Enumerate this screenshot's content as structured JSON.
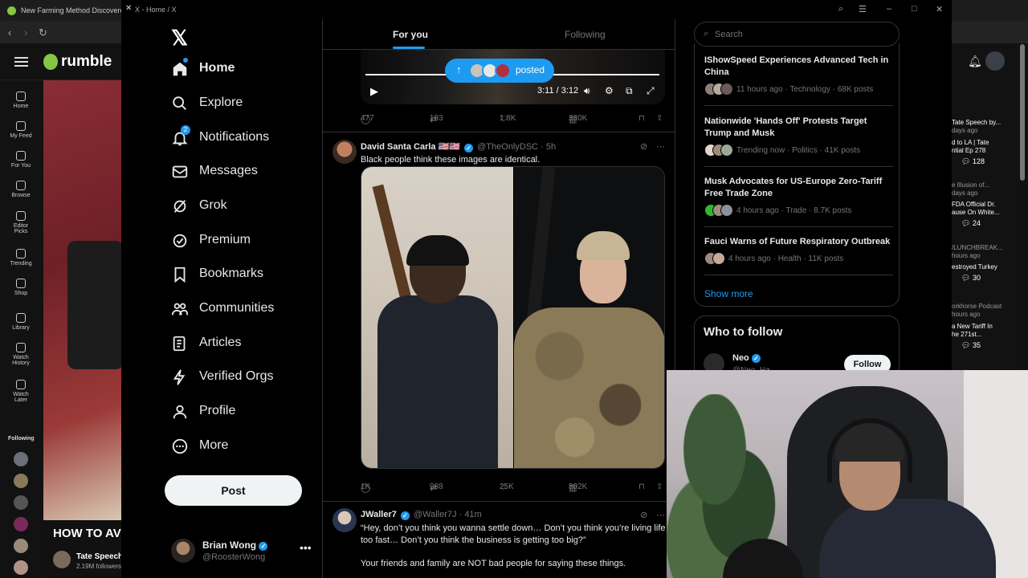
{
  "rumble": {
    "tab_title": "New Farming Method Discovered!",
    "logo": "rumble",
    "sidebar": [
      {
        "label": "Home"
      },
      {
        "label": "My Feed"
      },
      {
        "label": "For You"
      },
      {
        "label": "Browse"
      },
      {
        "label": "Editor Picks"
      },
      {
        "label": "Trending"
      },
      {
        "label": "Shop"
      },
      {
        "label": "Library"
      },
      {
        "label": "Watch History"
      },
      {
        "label": "Watch Later"
      }
    ],
    "following_label": "Following",
    "video_title": "HOW TO AV",
    "channel_name": "Tate Speech",
    "channel_followers": "2.19M followers",
    "right_list": [
      {
        "line1": "Tate Speech by...",
        "line2": "days ago",
        "comments": ""
      },
      {
        "line1": "d to LA | Tate",
        "line2": "ntial Ep 278",
        "comments": "128"
      },
      {
        "line1": "e Illusion of...",
        "line2": "days ago",
        "comments": ""
      },
      {
        "line1": "FDA Official Dr.",
        "line2": "ause On White...",
        "comments": "24"
      },
      {
        "line1": "/LUNCHBREAK...",
        "line2": "hours ago",
        "comments": ""
      },
      {
        "line1": "estroyed Turkey",
        "line2": "",
        "comments": "30"
      },
      {
        "line1": "orkhorse Podcast",
        "line2": "hours ago",
        "comments": ""
      },
      {
        "line1": "a New Tariff In",
        "line2": "he 271st...",
        "comments": "35"
      }
    ]
  },
  "x": {
    "window_title": "X - Home / X",
    "logo": "𝕏",
    "nav": [
      {
        "key": "home",
        "label": "Home",
        "icon": "home-icon"
      },
      {
        "key": "explore",
        "label": "Explore",
        "icon": "search-icon"
      },
      {
        "key": "notifications",
        "label": "Notifications",
        "icon": "bell-icon",
        "badge": "2"
      },
      {
        "key": "messages",
        "label": "Messages",
        "icon": "envelope-icon"
      },
      {
        "key": "grok",
        "label": "Grok",
        "icon": "grok-icon"
      },
      {
        "key": "premium",
        "label": "Premium",
        "icon": "premium-icon"
      },
      {
        "key": "bookmarks",
        "label": "Bookmarks",
        "icon": "bookmark-icon"
      },
      {
        "key": "communities",
        "label": "Communities",
        "icon": "people-icon"
      },
      {
        "key": "articles",
        "label": "Articles",
        "icon": "article-icon"
      },
      {
        "key": "verified_orgs",
        "label": "Verified Orgs",
        "icon": "lightning-icon"
      },
      {
        "key": "profile",
        "label": "Profile",
        "icon": "person-icon"
      },
      {
        "key": "more",
        "label": "More",
        "icon": "more-circle-icon"
      }
    ],
    "post_button": "Post",
    "account": {
      "name": "Brian Wong",
      "handle": "@RoosterWong"
    },
    "tabs": {
      "for_you": "For you",
      "following": "Following"
    },
    "video": {
      "time": "3:11 / 3:12"
    },
    "posted_pill": "posted",
    "tweet0_stats": {
      "replies": "477",
      "reposts": "193",
      "likes": "1.8K",
      "views": "330K"
    },
    "tweet1": {
      "name": "David Santa Carla",
      "flags": "🇺🇸🇺🇸",
      "handle": "@TheOnlyDSC",
      "time": "5h",
      "text": "Black people think these images are identical.",
      "stats": {
        "replies": "1K",
        "reposts": "988",
        "likes": "25K",
        "views": "802K"
      }
    },
    "tweet2": {
      "name": "JWaller7",
      "handle": "@Waller7J",
      "time": "41m",
      "text": "“Hey, don’t you think you wanna settle down… Don’t you think you’re living life too fast… Don’t you think the business is getting too big?”",
      "text2": "Your friends and family are NOT bad people for saying these things."
    },
    "search": {
      "placeholder": "Search"
    },
    "news": [
      {
        "title": "IShowSpeed Experiences Advanced Tech in China",
        "meta": "11 hours ago · Technology · 68K posts"
      },
      {
        "title": "Nationwide 'Hands Off' Protests Target Trump and Musk",
        "meta": "Trending now · Politics · 41K posts"
      },
      {
        "title": "Musk Advocates for US-Europe Zero-Tariff Free Trade Zone",
        "meta": "4 hours ago · Trade · 8.7K posts"
      },
      {
        "title": "Fauci Warns of Future Respiratory Outbreak",
        "meta": "4 hours ago · Health · 11K posts"
      }
    ],
    "show_more": "Show more",
    "who_to_follow": {
      "title": "Who to follow",
      "name": "Neo",
      "handle": "@Neo_Ha...",
      "button": "Follow"
    }
  }
}
